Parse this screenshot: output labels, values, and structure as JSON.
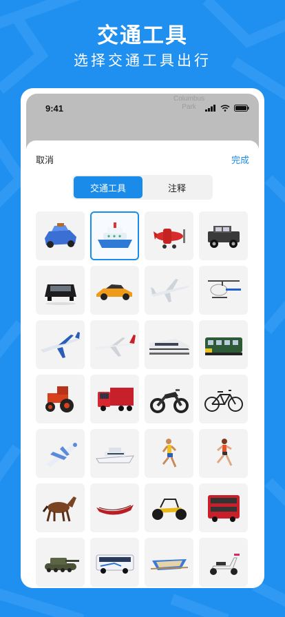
{
  "hero": {
    "title": "交通工具",
    "subtitle": "选择交通工具出行"
  },
  "status_bar": {
    "time": "9:41",
    "map_label_line1": "Columbus",
    "map_label_line2": "Park"
  },
  "sheet": {
    "cancel_label": "取消",
    "done_label": "完成",
    "tabs": [
      {
        "label": "交通工具",
        "active": true
      },
      {
        "label": "注释",
        "active": false
      }
    ]
  },
  "vehicles": [
    {
      "name": "toy-car",
      "selected": false
    },
    {
      "name": "ship",
      "selected": true
    },
    {
      "name": "propeller-plane",
      "selected": false
    },
    {
      "name": "jeep",
      "selected": false
    },
    {
      "name": "black-suv",
      "selected": false
    },
    {
      "name": "sports-car",
      "selected": false
    },
    {
      "name": "airliner",
      "selected": false
    },
    {
      "name": "helicopter",
      "selected": false
    },
    {
      "name": "blue-jet",
      "selected": false
    },
    {
      "name": "red-tail-jet",
      "selected": false
    },
    {
      "name": "bullet-train",
      "selected": false
    },
    {
      "name": "green-train",
      "selected": false
    },
    {
      "name": "tractor",
      "selected": false
    },
    {
      "name": "red-truck",
      "selected": false
    },
    {
      "name": "motorcycle",
      "selected": false
    },
    {
      "name": "bicycle",
      "selected": false
    },
    {
      "name": "cartoon-plane",
      "selected": false
    },
    {
      "name": "yacht",
      "selected": false
    },
    {
      "name": "runner-man",
      "selected": false
    },
    {
      "name": "runner-woman",
      "selected": false
    },
    {
      "name": "horse",
      "selected": false
    },
    {
      "name": "canoe",
      "selected": false
    },
    {
      "name": "dune-buggy",
      "selected": false
    },
    {
      "name": "double-decker-bus",
      "selected": false
    },
    {
      "name": "tank",
      "selected": false
    },
    {
      "name": "coach-bus",
      "selected": false
    },
    {
      "name": "rowboat",
      "selected": false
    },
    {
      "name": "scooter",
      "selected": false
    }
  ],
  "colors": {
    "background": "#1f8ff0",
    "accent": "#1a8be8"
  }
}
